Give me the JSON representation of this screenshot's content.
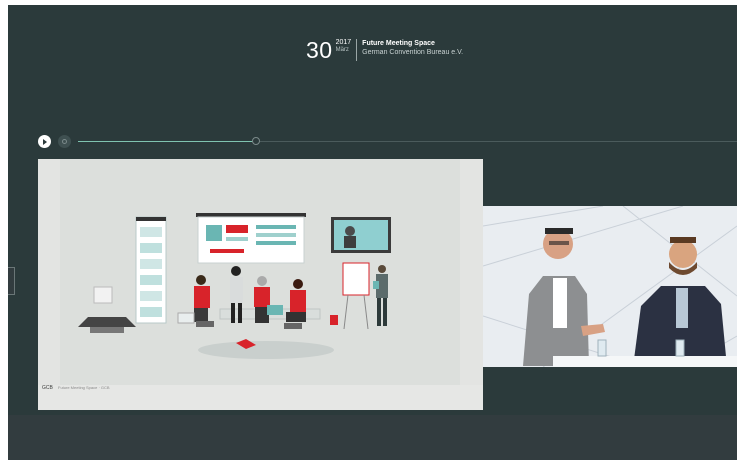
{
  "header": {
    "day": "30",
    "year": "2017",
    "month": "März",
    "event_title": "Future Meeting Space",
    "event_subtitle": "German Convention Bureau e.V."
  },
  "player": {
    "progress": 0.27
  },
  "slide": {
    "logo_text": "GCB",
    "footer_text": "Future Meeting Space · GCB"
  },
  "colors": {
    "background": "#2b3a3b",
    "accent_progress": "#7fc3b0",
    "brand_red": "#d8232a",
    "teal": "#6ab6b3"
  },
  "icons": {
    "play": "play-icon",
    "volume": "volume-icon",
    "scrub": "scrub-handle"
  }
}
